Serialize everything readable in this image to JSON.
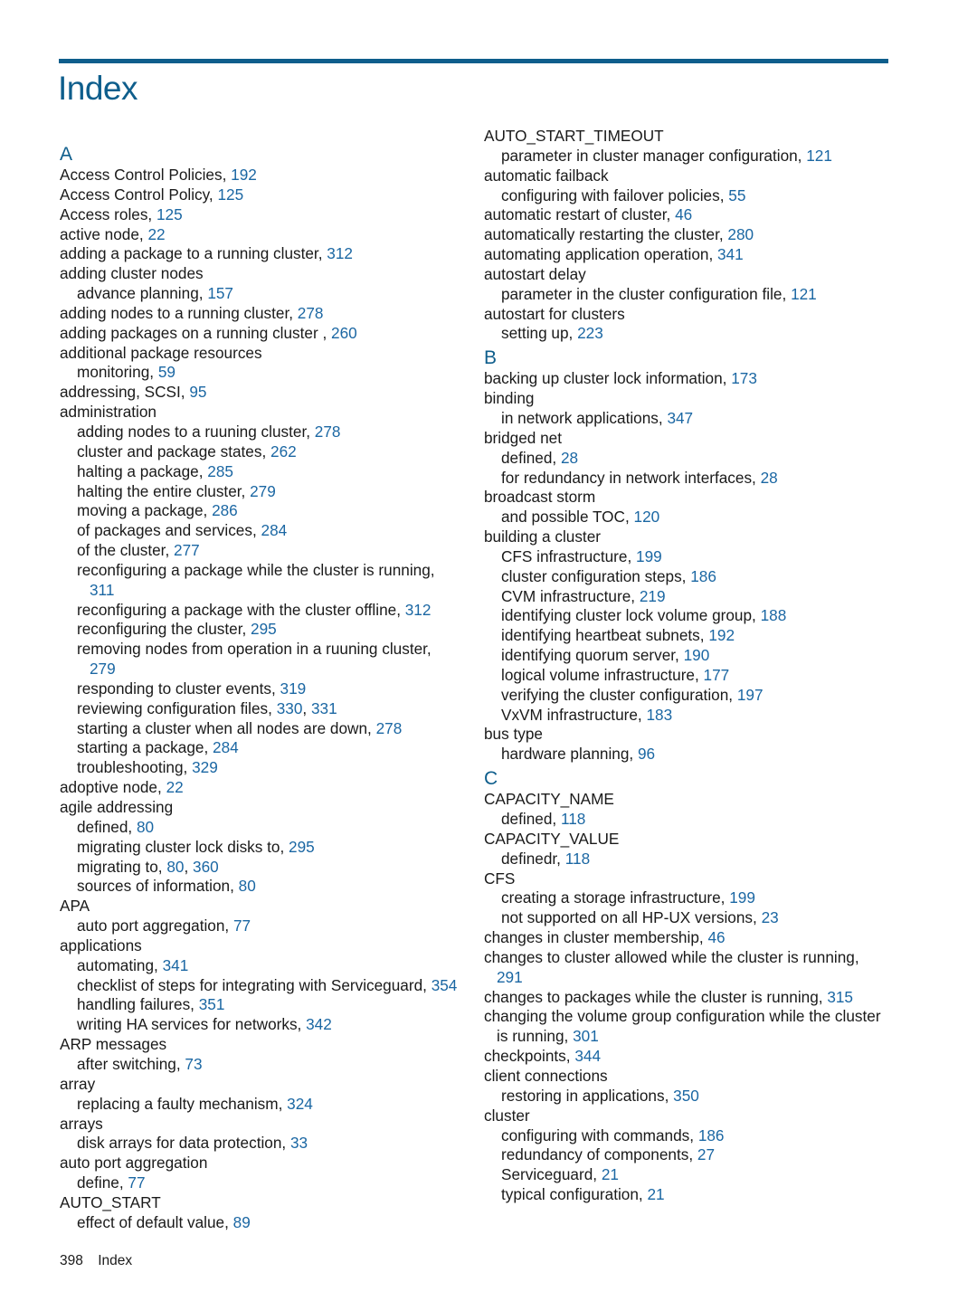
{
  "page": {
    "title": "Index",
    "footer": {
      "page_number": "398",
      "section": "Index"
    },
    "colors": {
      "accent": "#0e5e8c",
      "link": "#1b67a3",
      "text": "#1a1a1a"
    }
  },
  "left_column": [
    {
      "type": "letter",
      "text": "A"
    },
    {
      "type": "entry",
      "level": 0,
      "text": "Access Control Policies,",
      "pages": [
        "192"
      ]
    },
    {
      "type": "entry",
      "level": 0,
      "text": "Access Control Policy,",
      "pages": [
        "125"
      ]
    },
    {
      "type": "entry",
      "level": 0,
      "text": "Access roles,",
      "pages": [
        "125"
      ]
    },
    {
      "type": "entry",
      "level": 0,
      "text": "active node,",
      "pages": [
        "22"
      ]
    },
    {
      "type": "entry",
      "level": 0,
      "text": "adding a package to a running cluster,",
      "pages": [
        "312"
      ]
    },
    {
      "type": "entry",
      "level": 0,
      "text": "adding cluster nodes",
      "pages": []
    },
    {
      "type": "entry",
      "level": 1,
      "text": "advance planning,",
      "pages": [
        "157"
      ]
    },
    {
      "type": "entry",
      "level": 0,
      "text": "adding nodes to a running cluster,",
      "pages": [
        "278"
      ]
    },
    {
      "type": "entry",
      "level": 0,
      "text": "adding packages on a running cluster ,",
      "pages": [
        "260"
      ]
    },
    {
      "type": "entry",
      "level": 0,
      "text": "additional package resources",
      "pages": []
    },
    {
      "type": "entry",
      "level": 1,
      "text": "monitoring,",
      "pages": [
        "59"
      ]
    },
    {
      "type": "entry",
      "level": 0,
      "text": "addressing, SCSI,",
      "pages": [
        "95"
      ]
    },
    {
      "type": "entry",
      "level": 0,
      "text": "administration",
      "pages": []
    },
    {
      "type": "entry",
      "level": 1,
      "text": "adding nodes to a ruuning cluster,",
      "pages": [
        "278"
      ]
    },
    {
      "type": "entry",
      "level": 1,
      "text": "cluster and package states,",
      "pages": [
        "262"
      ]
    },
    {
      "type": "entry",
      "level": 1,
      "text": "halting a package,",
      "pages": [
        "285"
      ]
    },
    {
      "type": "entry",
      "level": 1,
      "text": "halting the entire cluster,",
      "pages": [
        "279"
      ]
    },
    {
      "type": "entry",
      "level": 1,
      "text": "moving a package,",
      "pages": [
        "286"
      ]
    },
    {
      "type": "entry",
      "level": 1,
      "text": "of packages and services,",
      "pages": [
        "284"
      ]
    },
    {
      "type": "entry",
      "level": 1,
      "text": "of the cluster,",
      "pages": [
        "277"
      ]
    },
    {
      "type": "entry",
      "level": 1,
      "text": "reconfiguring a package while the cluster is running,",
      "pages": [
        "311"
      ],
      "wrap": true
    },
    {
      "type": "entry",
      "level": 1,
      "text": "reconfiguring a package with the cluster offline,",
      "pages": [
        "312"
      ]
    },
    {
      "type": "entry",
      "level": 1,
      "text": "reconfiguring the cluster,",
      "pages": [
        "295"
      ]
    },
    {
      "type": "entry",
      "level": 1,
      "text": "removing nodes from operation in a ruuning cluster,",
      "pages": [
        "279"
      ],
      "wrap": true
    },
    {
      "type": "entry",
      "level": 1,
      "text": "responding to cluster events,",
      "pages": [
        "319"
      ]
    },
    {
      "type": "entry",
      "level": 1,
      "text": "reviewing configuration files,",
      "pages": [
        "330",
        "331"
      ]
    },
    {
      "type": "entry",
      "level": 1,
      "text": "starting a cluster when all nodes are down,",
      "pages": [
        "278"
      ]
    },
    {
      "type": "entry",
      "level": 1,
      "text": "starting a package,",
      "pages": [
        "284"
      ]
    },
    {
      "type": "entry",
      "level": 1,
      "text": "troubleshooting,",
      "pages": [
        "329"
      ]
    },
    {
      "type": "entry",
      "level": 0,
      "text": "adoptive node,",
      "pages": [
        "22"
      ]
    },
    {
      "type": "entry",
      "level": 0,
      "text": "agile addressing",
      "pages": []
    },
    {
      "type": "entry",
      "level": 1,
      "text": "defined,",
      "pages": [
        "80"
      ]
    },
    {
      "type": "entry",
      "level": 1,
      "text": "migrating cluster lock disks to,",
      "pages": [
        "295"
      ]
    },
    {
      "type": "entry",
      "level": 1,
      "text": "migrating to,",
      "pages": [
        "80",
        "360"
      ]
    },
    {
      "type": "entry",
      "level": 1,
      "text": "sources of information,",
      "pages": [
        "80"
      ]
    },
    {
      "type": "entry",
      "level": 0,
      "text": "APA",
      "pages": []
    },
    {
      "type": "entry",
      "level": 1,
      "text": "auto port aggregation,",
      "pages": [
        "77"
      ]
    },
    {
      "type": "entry",
      "level": 0,
      "text": "applications",
      "pages": []
    },
    {
      "type": "entry",
      "level": 1,
      "text": "automating,",
      "pages": [
        "341"
      ]
    },
    {
      "type": "entry",
      "level": 1,
      "text": "checklist of steps for integrating with Serviceguard,",
      "pages": [
        "354"
      ]
    },
    {
      "type": "entry",
      "level": 1,
      "text": "handling failures,",
      "pages": [
        "351"
      ]
    },
    {
      "type": "entry",
      "level": 1,
      "text": "writing HA services for networks,",
      "pages": [
        "342"
      ]
    },
    {
      "type": "entry",
      "level": 0,
      "text": "ARP messages",
      "pages": []
    },
    {
      "type": "entry",
      "level": 1,
      "text": "after switching,",
      "pages": [
        "73"
      ]
    },
    {
      "type": "entry",
      "level": 0,
      "text": "array",
      "pages": []
    },
    {
      "type": "entry",
      "level": 1,
      "text": "replacing a faulty mechanism,",
      "pages": [
        "324"
      ]
    },
    {
      "type": "entry",
      "level": 0,
      "text": "arrays",
      "pages": []
    },
    {
      "type": "entry",
      "level": 1,
      "text": "disk arrays for data protection,",
      "pages": [
        "33"
      ]
    },
    {
      "type": "entry",
      "level": 0,
      "text": "auto port aggregation",
      "pages": []
    },
    {
      "type": "entry",
      "level": 1,
      "text": "define,",
      "pages": [
        "77"
      ]
    },
    {
      "type": "entry",
      "level": 0,
      "text": "AUTO_START",
      "pages": []
    },
    {
      "type": "entry",
      "level": 1,
      "text": "effect of default value,",
      "pages": [
        "89"
      ]
    }
  ],
  "right_column": [
    {
      "type": "entry",
      "level": 0,
      "text": "AUTO_START_TIMEOUT",
      "pages": []
    },
    {
      "type": "entry",
      "level": 1,
      "text": "parameter in cluster manager configuration,",
      "pages": [
        "121"
      ]
    },
    {
      "type": "entry",
      "level": 0,
      "text": "automatic failback",
      "pages": []
    },
    {
      "type": "entry",
      "level": 1,
      "text": "configuring with failover policies,",
      "pages": [
        "55"
      ]
    },
    {
      "type": "entry",
      "level": 0,
      "text": "automatic restart of cluster,",
      "pages": [
        "46"
      ]
    },
    {
      "type": "entry",
      "level": 0,
      "text": "automatically restarting the cluster,",
      "pages": [
        "280"
      ]
    },
    {
      "type": "entry",
      "level": 0,
      "text": "automating application operation,",
      "pages": [
        "341"
      ]
    },
    {
      "type": "entry",
      "level": 0,
      "text": "autostart delay",
      "pages": []
    },
    {
      "type": "entry",
      "level": 1,
      "text": "parameter in the cluster configuration file,",
      "pages": [
        "121"
      ]
    },
    {
      "type": "entry",
      "level": 0,
      "text": "autostart for clusters",
      "pages": []
    },
    {
      "type": "entry",
      "level": 1,
      "text": "setting up,",
      "pages": [
        "223"
      ]
    },
    {
      "type": "letter",
      "text": "B"
    },
    {
      "type": "entry",
      "level": 0,
      "text": "backing up cluster lock information,",
      "pages": [
        "173"
      ]
    },
    {
      "type": "entry",
      "level": 0,
      "text": "binding",
      "pages": []
    },
    {
      "type": "entry",
      "level": 1,
      "text": "in network applications,",
      "pages": [
        "347"
      ]
    },
    {
      "type": "entry",
      "level": 0,
      "text": "bridged net",
      "pages": []
    },
    {
      "type": "entry",
      "level": 1,
      "text": "defined,",
      "pages": [
        "28"
      ]
    },
    {
      "type": "entry",
      "level": 1,
      "text": "for redundancy in network interfaces,",
      "pages": [
        "28"
      ]
    },
    {
      "type": "entry",
      "level": 0,
      "text": "broadcast storm",
      "pages": []
    },
    {
      "type": "entry",
      "level": 1,
      "text": "and possible TOC,",
      "pages": [
        "120"
      ]
    },
    {
      "type": "entry",
      "level": 0,
      "text": "building a cluster",
      "pages": []
    },
    {
      "type": "entry",
      "level": 1,
      "text": "CFS infrastructure,",
      "pages": [
        "199"
      ]
    },
    {
      "type": "entry",
      "level": 1,
      "text": "cluster configuration steps,",
      "pages": [
        "186"
      ]
    },
    {
      "type": "entry",
      "level": 1,
      "text": "CVM infrastructure,",
      "pages": [
        "219"
      ]
    },
    {
      "type": "entry",
      "level": 1,
      "text": "identifying cluster lock volume group,",
      "pages": [
        "188"
      ]
    },
    {
      "type": "entry",
      "level": 1,
      "text": "identifying heartbeat subnets,",
      "pages": [
        "192"
      ]
    },
    {
      "type": "entry",
      "level": 1,
      "text": "identifying quorum server,",
      "pages": [
        "190"
      ]
    },
    {
      "type": "entry",
      "level": 1,
      "text": "logical volume infrastructure,",
      "pages": [
        "177"
      ]
    },
    {
      "type": "entry",
      "level": 1,
      "text": "verifying the cluster configuration,",
      "pages": [
        "197"
      ]
    },
    {
      "type": "entry",
      "level": 1,
      "text": "VxVM infrastructure,",
      "pages": [
        "183"
      ]
    },
    {
      "type": "entry",
      "level": 0,
      "text": "bus type",
      "pages": []
    },
    {
      "type": "entry",
      "level": 1,
      "text": "hardware planning,",
      "pages": [
        "96"
      ]
    },
    {
      "type": "letter",
      "text": "C"
    },
    {
      "type": "entry",
      "level": 0,
      "text": "CAPACITY_NAME",
      "pages": []
    },
    {
      "type": "entry",
      "level": 1,
      "text": "defined,",
      "pages": [
        "118"
      ]
    },
    {
      "type": "entry",
      "level": 0,
      "text": "CAPACITY_VALUE",
      "pages": []
    },
    {
      "type": "entry",
      "level": 1,
      "text": "definedr,",
      "pages": [
        "118"
      ]
    },
    {
      "type": "entry",
      "level": 0,
      "text": "CFS",
      "pages": []
    },
    {
      "type": "entry",
      "level": 1,
      "text": "creating a storage infrastructure,",
      "pages": [
        "199"
      ]
    },
    {
      "type": "entry",
      "level": 1,
      "text": "not supported on all HP-UX versions,",
      "pages": [
        "23"
      ]
    },
    {
      "type": "entry",
      "level": 0,
      "text": "changes in cluster membership,",
      "pages": [
        "46"
      ]
    },
    {
      "type": "entry",
      "level": 0,
      "text": "changes to cluster allowed while the cluster is running,",
      "pages": [
        "291"
      ],
      "wrap": true
    },
    {
      "type": "entry",
      "level": 0,
      "text": "changes to packages while the cluster is running,",
      "pages": [
        "315"
      ]
    },
    {
      "type": "entry",
      "level": 0,
      "text": "changing the volume group configuration while the cluster",
      "cont_text": "is running,",
      "pages": [
        "301"
      ],
      "wrap": true
    },
    {
      "type": "entry",
      "level": 0,
      "text": "checkpoints,",
      "pages": [
        "344"
      ]
    },
    {
      "type": "entry",
      "level": 0,
      "text": "client connections",
      "pages": []
    },
    {
      "type": "entry",
      "level": 1,
      "text": "restoring in applications,",
      "pages": [
        "350"
      ]
    },
    {
      "type": "entry",
      "level": 0,
      "text": "cluster",
      "pages": []
    },
    {
      "type": "entry",
      "level": 1,
      "text": "configuring with commands,",
      "pages": [
        "186"
      ]
    },
    {
      "type": "entry",
      "level": 1,
      "text": "redundancy of components,",
      "pages": [
        "27"
      ]
    },
    {
      "type": "entry",
      "level": 1,
      "text": "Serviceguard,",
      "pages": [
        "21"
      ]
    },
    {
      "type": "entry",
      "level": 1,
      "text": "typical configuration,",
      "pages": [
        "21"
      ]
    }
  ]
}
